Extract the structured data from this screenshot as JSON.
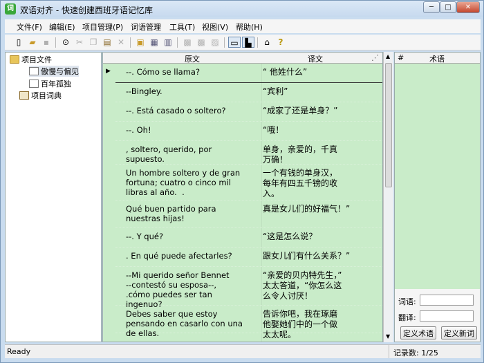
{
  "app": {
    "title": "双语对齐 - 快速创建西班牙语记忆库",
    "icon": "app-logo"
  },
  "window_buttons": {
    "minimize": "─",
    "maximize": "□",
    "close": "✕"
  },
  "menu": [
    "文件(F)",
    "编辑(E)",
    "项目管理(P)",
    "词语管理",
    "工具(T)",
    "视图(V)",
    "帮助(H)"
  ],
  "tree": {
    "root": "项目文件",
    "children": [
      "傲慢与偏见",
      "百年孤独"
    ],
    "glossary": "项目词典"
  },
  "grid": {
    "col_source": "原文",
    "col_target": "译文",
    "rows": [
      {
        "src": "--. Cómo se llama?",
        "tgt": "“ 他姓什么”"
      },
      {
        "src": "--Bingley.",
        "tgt": "“宾利”"
      },
      {
        "src": "--. Está casado o soltero?",
        "tgt": "“成家了还是单身？”"
      },
      {
        "src": "--. Oh!",
        "tgt": "“哦！"
      },
      {
        "src": ", soltero, querido, por supuesto.",
        "tgt": "单身，亲爱的，千真\n万确！"
      },
      {
        "src": "Un hombre soltero y de gran\nfortuna; cuatro o cinco mil\nlibras al año.  .",
        "tgt": "一个有钱的单身汉，\n每年有四五千镑的收\n入。"
      },
      {
        "src": "Qué buen partido para\nnuestras hijas!",
        "tgt": "真是女儿们的好福气！”"
      },
      {
        "src": "--. Y qué?",
        "tgt": "“这是怎么说？"
      },
      {
        "src": ". En qué puede afectarles?",
        "tgt": "跟女儿们有什么关系？”"
      },
      {
        "src": "--Mi querido señor Bennet\n--contestó su esposa--,\n.cómo puedes ser tan ingenuo?",
        "tgt": "“亲爱的贝内特先生，”\n太太答道，“你怎么这\n么令人讨厌！"
      },
      {
        "src": "Debes saber que estoy\npensando en casarlo con una\nde ellas.",
        "tgt": "告诉你吧，我在琢磨\n他娶她们中的一个做\n太太呢。"
      }
    ]
  },
  "term_panel": {
    "col_num": "#",
    "col_term": "术语",
    "label_word": "词语:",
    "label_translation": "翻译:",
    "btn_define_term": "定义术语",
    "btn_define_new": "定义新词"
  },
  "status": {
    "left": "Ready",
    "right": "记录数: 1/25"
  }
}
